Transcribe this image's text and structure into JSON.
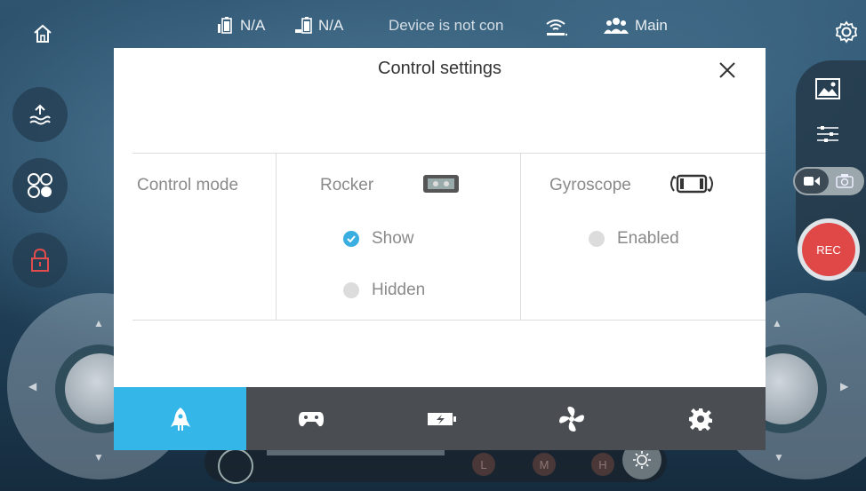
{
  "status": {
    "battery1": "N/A",
    "battery2": "N/A",
    "connection": "Device is not con",
    "user": "Main"
  },
  "right_panel": {
    "rec_label": "REC"
  },
  "bottom": {
    "modes": [
      "L",
      "M",
      "H"
    ]
  },
  "modal": {
    "title": "Control settings",
    "control_mode_label": "Control mode",
    "rocker": {
      "label": "Rocker",
      "options": [
        {
          "label": "Show",
          "selected": true
        },
        {
          "label": "Hidden",
          "selected": false
        }
      ]
    },
    "gyroscope": {
      "label": "Gyroscope",
      "options": [
        {
          "label": "Enabled",
          "selected": false
        }
      ]
    },
    "tabs": [
      {
        "name": "rocket",
        "active": true
      },
      {
        "name": "gamepad",
        "active": false
      },
      {
        "name": "battery",
        "active": false
      },
      {
        "name": "fan",
        "active": false
      },
      {
        "name": "gear",
        "active": false
      }
    ]
  },
  "colors": {
    "accent": "#34b7e8",
    "rec": "#e04848",
    "tabbar": "#4a4d51"
  }
}
